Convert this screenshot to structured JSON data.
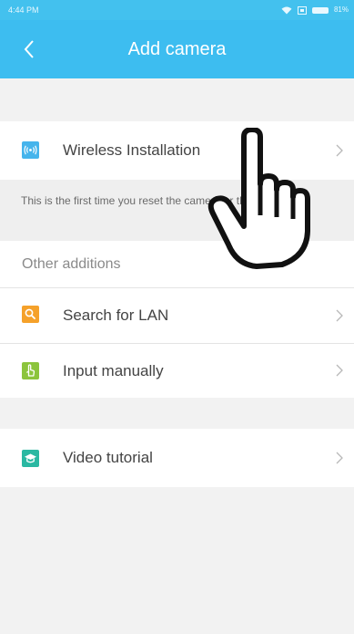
{
  "status_bar": {
    "time": "4:44 PM",
    "battery": "81%"
  },
  "app_bar": {
    "title": "Add camera"
  },
  "wireless_section": {
    "label": "Wireless Installation",
    "icon": "wireless-icon",
    "note": "This is the first time you reset the camera or the camcorder"
  },
  "other_section": {
    "header": "Other additions",
    "items": [
      {
        "label": "Search for LAN",
        "icon": "search-icon",
        "color": "#f5a12a"
      },
      {
        "label": "Input manually",
        "icon": "hand-icon",
        "color": "#8cc43c"
      }
    ]
  },
  "tutorial_section": {
    "label": "Video tutorial",
    "icon": "graduation-cap-icon",
    "color": "#2ab8a2"
  },
  "colors": {
    "app_bar": "#3dbdf0",
    "wireless_icon": "#45b4ec",
    "background": "#f2f2f2"
  }
}
